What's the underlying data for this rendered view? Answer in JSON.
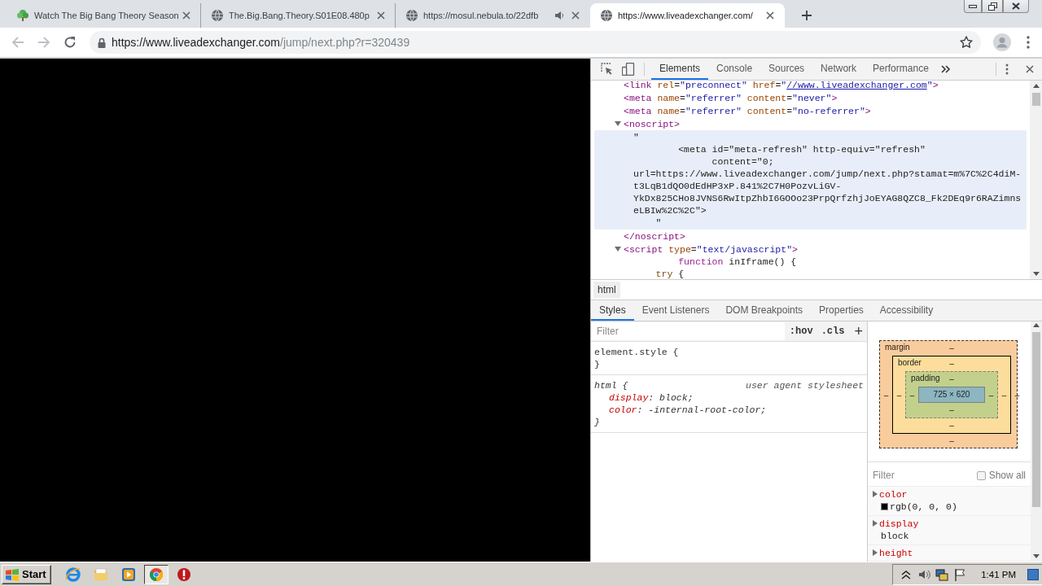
{
  "browser": {
    "tabs": [
      {
        "title": "Watch The Big Bang Theory Season",
        "kind": "site",
        "audio": false,
        "selected": false
      },
      {
        "title": "The.Big.Bang.Theory.S01E08.480p",
        "kind": "default",
        "audio": false,
        "selected": false
      },
      {
        "title": "https://mosul.nebula.to/22dfb",
        "kind": "default",
        "audio": true,
        "selected": false
      },
      {
        "title": "https://www.liveadexchanger.com/",
        "kind": "default",
        "audio": false,
        "selected": true
      }
    ],
    "address": {
      "host": "https://www.liveadexchanger.com",
      "path": "/jump/next.php?r=320439"
    },
    "bookmarked": false
  },
  "devtools": {
    "tabs": [
      {
        "label": "Elements",
        "selected": true
      },
      {
        "label": "Console",
        "selected": false
      },
      {
        "label": "Sources",
        "selected": false
      },
      {
        "label": "Network",
        "selected": false
      },
      {
        "label": "Performance",
        "selected": false
      }
    ],
    "dom": [
      {
        "parts": [
          {
            "kind": "tag",
            "text": "<link"
          },
          {
            "kind": "attr",
            "text": " rel"
          },
          {
            "kind": "punct",
            "text": "="
          },
          {
            "kind": "value",
            "text": "\"preconnect\""
          },
          {
            "kind": "attr",
            "text": " href"
          },
          {
            "kind": "punct",
            "text": "="
          },
          {
            "kind": "value",
            "text": "\""
          },
          {
            "kind": "link",
            "text": "//www.liveadexchanger.com"
          },
          {
            "kind": "value",
            "text": "\""
          },
          {
            "kind": "tag",
            "text": ">"
          }
        ]
      },
      {
        "parts": [
          {
            "kind": "tag",
            "text": "<meta"
          },
          {
            "kind": "attr",
            "text": " name"
          },
          {
            "kind": "punct",
            "text": "="
          },
          {
            "kind": "value",
            "text": "\"referrer\""
          },
          {
            "kind": "attr",
            "text": " content"
          },
          {
            "kind": "punct",
            "text": "="
          },
          {
            "kind": "value",
            "text": "\"never\""
          },
          {
            "kind": "tag",
            "text": ">"
          }
        ]
      },
      {
        "parts": [
          {
            "kind": "tag",
            "text": "<meta"
          },
          {
            "kind": "attr",
            "text": " name"
          },
          {
            "kind": "punct",
            "text": "="
          },
          {
            "kind": "value",
            "text": "\"referrer\""
          },
          {
            "kind": "attr",
            "text": " content"
          },
          {
            "kind": "punct",
            "text": "="
          },
          {
            "kind": "value",
            "text": "\"no-referrer\""
          },
          {
            "kind": "tag",
            "text": ">"
          }
        ]
      },
      {
        "parts": [
          {
            "kind": "tag",
            "text": "<noscript>"
          }
        ],
        "expanded": true,
        "children": [
          {
            "kind": "text",
            "hovered": true,
            "lines": [
              [
                {
                  "kind": "text",
                  "text": "\""
                }
              ],
              [
                {
                  "kind": "text",
                  "text": "        <meta id=\"meta-refresh\" http-equiv=\"refresh\""
                }
              ],
              [
                {
                  "kind": "text",
                  "text": "              content=\"0;"
                }
              ],
              [
                {
                  "kind": "text",
                  "text": "url=https://www.liveadexchanger.com/jump/next.php?stamat=m%7C%2C4diM-"
                }
              ],
              [
                {
                  "kind": "text",
                  "text": "t3LqB1dQO0dEdHP3xP.841%2C7H0PozvLiGV-"
                }
              ],
              [
                {
                  "kind": "text",
                  "text": "YkDx825CHo8JVNS6RwItpZhbI6GOOo23PrpQrfzhjJoEYAG8QZC8_Fk2DEq9r6RAZimns"
                }
              ],
              [
                {
                  "kind": "text",
                  "text": "eLBIw%2C%2C\">"
                }
              ],
              [
                {
                  "kind": "text",
                  "text": "    \""
                }
              ]
            ]
          }
        ],
        "end": [
          {
            "kind": "tag",
            "text": "</noscript>"
          }
        ]
      },
      {
        "parts": [
          {
            "kind": "tag",
            "text": "<script"
          },
          {
            "kind": "attr",
            "text": " type"
          },
          {
            "kind": "punct",
            "text": "="
          },
          {
            "kind": "value",
            "text": "\"text/javascript\""
          },
          {
            "kind": "tag",
            "text": ">"
          }
        ],
        "expanded": true,
        "children": [
          {
            "kind": "text",
            "hovered": false,
            "lines": [
              [
                {
                  "kind": "keyword",
                  "text": "        function"
                },
                {
                  "kind": "text",
                  "text": " inIframe() {"
                }
              ],
              [
                {
                  "kind": "keyword2",
                  "text": "    try"
                },
                {
                  "kind": "text",
                  "text": " {"
                }
              ]
            ]
          }
        ]
      }
    ],
    "breadcrumb": "html",
    "sidebar_tabs": [
      {
        "label": "Styles",
        "selected": true
      },
      {
        "label": "Event Listeners",
        "selected": false
      },
      {
        "label": "DOM Breakpoints",
        "selected": false
      },
      {
        "label": "Properties",
        "selected": false
      },
      {
        "label": "Accessibility",
        "selected": false
      }
    ],
    "styles": {
      "filter_placeholder": "Filter",
      "hov": ":hov",
      "cls": ".cls",
      "add": "+",
      "separator": ":",
      "rules": [
        {
          "selector": "element.style {",
          "end": "}"
        },
        {
          "selector": "html {",
          "origin": "user agent stylesheet",
          "declarations": [
            {
              "property": "display",
              "value": " block;"
            },
            {
              "property": "color",
              "value": " -internal-root-color;"
            }
          ],
          "end": "}"
        }
      ]
    },
    "box_model": {
      "layers": [
        {
          "kind": "margin",
          "label": "margin",
          "top": "–",
          "left": "–"
        },
        {
          "kind": "border",
          "label": "border",
          "top": "–",
          "left": "–"
        },
        {
          "kind": "padding",
          "label": "padding",
          "top": "–",
          "left": "–"
        }
      ],
      "content": "725 × 620",
      "right": [
        "–",
        "–",
        "–"
      ],
      "bottom": [
        "–",
        "–",
        "–"
      ]
    },
    "computed": {
      "filter_placeholder": "Filter",
      "show_all": {
        "label": "Show all",
        "checked": false
      },
      "properties": [
        {
          "name": "color",
          "value": "rgb(0, 0, 0)",
          "color": "#000000",
          "expanded": false
        },
        {
          "name": "display",
          "value": "block",
          "expanded": false
        },
        {
          "name": "height",
          "expanded": false
        }
      ]
    }
  },
  "taskbar": {
    "start": "Start",
    "apps": [
      {
        "kind": "ie",
        "selected": false
      },
      {
        "kind": "folder",
        "selected": false
      },
      {
        "kind": "media",
        "selected": false
      },
      {
        "kind": "chrome",
        "selected": true
      },
      {
        "kind": "stop",
        "selected": false
      }
    ],
    "clock": "1:41 PM"
  }
}
